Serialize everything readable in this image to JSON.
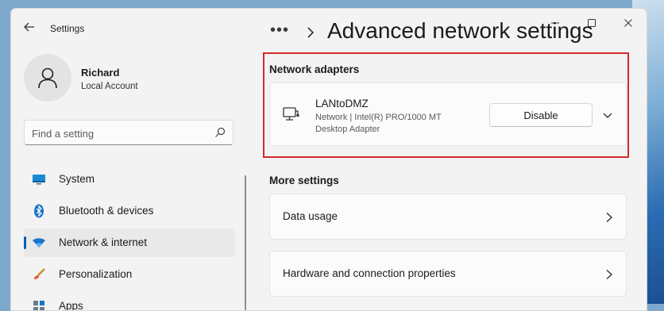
{
  "window": {
    "app_title": "Settings"
  },
  "user": {
    "name": "Richard",
    "account_type": "Local Account"
  },
  "search": {
    "placeholder": "Find a setting"
  },
  "sidebar": {
    "items": [
      {
        "label": "System",
        "icon": "system-icon"
      },
      {
        "label": "Bluetooth & devices",
        "icon": "bluetooth-icon"
      },
      {
        "label": "Network & internet",
        "icon": "wifi-icon",
        "selected": true
      },
      {
        "label": "Personalization",
        "icon": "brush-icon"
      },
      {
        "label": "Apps",
        "icon": "apps-icon"
      }
    ]
  },
  "breadcrumb": {
    "overflow": "•••",
    "title": "Advanced network settings"
  },
  "network_adapters": {
    "heading": "Network adapters",
    "adapter": {
      "name": "LANtoDMZ",
      "description_line1": "Network | Intel(R) PRO/1000 MT",
      "description_line2": "Desktop Adapter",
      "action_label": "Disable"
    }
  },
  "more_settings": {
    "heading": "More settings",
    "items": [
      {
        "label": "Data usage"
      },
      {
        "label": "Hardware and connection properties"
      }
    ]
  },
  "colors": {
    "accent": "#005fb8",
    "highlight_border": "#d42a2a",
    "window_bg": "#f3f3f3"
  }
}
